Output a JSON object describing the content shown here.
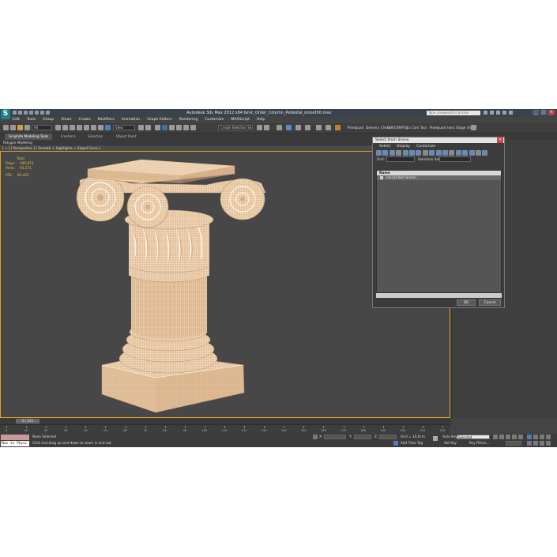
{
  "window": {
    "title": "Autodesk 3ds Max  2012 x64      Ionic_Order_Column_Pedestal_smooth0.max",
    "search_placeholder": "Type a keyword or phrase",
    "min": "_",
    "max": "□",
    "close": "×"
  },
  "menu": [
    "Edit",
    "Tools",
    "Group",
    "Views",
    "Create",
    "Modifiers",
    "Animation",
    "Graph Editors",
    "Rendering",
    "Customize",
    "MAXScript",
    "Help"
  ],
  "toolbar": {
    "filter": "All",
    "view": "View",
    "selection_set": "Create Selection Se",
    "right_labels": [
      "Pixelquad",
      "Delivery Check",
      "CHECKMATE",
      "Jiz Cam Tool",
      "Pixelquad",
      "Ionic Stage v6"
    ]
  },
  "ribbon": {
    "tabs": [
      "Graphite Modeling Tools",
      "Freeform",
      "Selection",
      "Object Paint"
    ],
    "subtitle": "Polygon Modeling"
  },
  "viewport": {
    "label": "[ + ] [ Perspective ] [ Smooth + Highlights + Edged Faces ]",
    "stats": {
      "total_label": "Total",
      "polys_label": "Polys:",
      "polys": "185,872",
      "verts_label": "Verts:",
      "verts": "93,271",
      "fps_label": "FPS:",
      "fps": "82.421"
    },
    "colors": {
      "frame": "#e3a11d",
      "mesh": "#e8c9a5",
      "wire": "#ffffff"
    }
  },
  "timeline": {
    "slider": "0 / 225",
    "ticks": [
      "0",
      "10",
      "20",
      "30",
      "40",
      "50",
      "60",
      "70",
      "80",
      "90",
      "100",
      "110",
      "120",
      "130",
      "140",
      "150",
      "160",
      "170",
      "180",
      "190",
      "200",
      "210",
      "220"
    ]
  },
  "status": {
    "maxscript": "Max to Physc",
    "selection": "None Selected",
    "prompt": "Click and drag up-and-down to zoom in and out",
    "x_label": "X:",
    "y_label": "Y:",
    "z_label": "Z:",
    "grid": "Grid = 10,0cm",
    "add_time_tag": "Add Time Tag",
    "auto_key": "Auto Key",
    "selected": "Selected",
    "set_key": "Set Key",
    "key_filters": "Key Filters..."
  },
  "dialog": {
    "title": "Select From Scene",
    "menu": [
      "Select",
      "Display",
      "Customize"
    ],
    "find_label": "Find:",
    "selection_set_label": "Selection Set:",
    "list_header": "Name",
    "rows": [
      "IonicOrderColumn"
    ],
    "ok": "OK",
    "cancel": "Cancel",
    "close": "×"
  }
}
